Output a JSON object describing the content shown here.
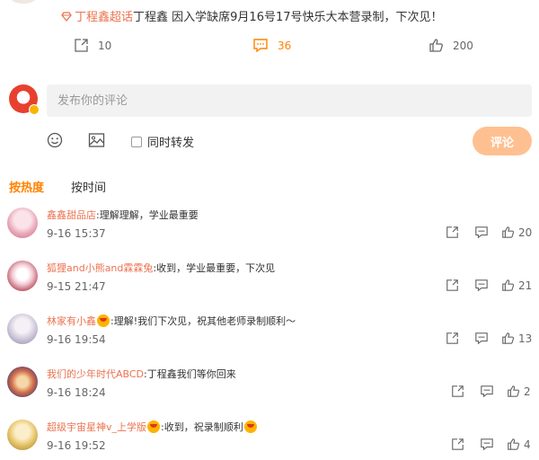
{
  "post": {
    "super_topic_link": "丁程鑫超话",
    "text": "丁程鑫 因入学缺席9月16号17号快乐大本营录制，下次见！",
    "repost_count": "10",
    "comment_count": "36",
    "like_count": "200"
  },
  "composer": {
    "placeholder": "发布你的评论",
    "repost_option": "同时转发",
    "submit_label": "评论",
    "icons": [
      "emoji-icon",
      "image-icon"
    ]
  },
  "sort_tabs": [
    {
      "label": "按热度",
      "active": true
    },
    {
      "label": "按时间",
      "active": false
    }
  ],
  "comments": [
    {
      "user": "鑫鑫甜品店",
      "text": ":理解理解，学业最重要",
      "emoji_after_user": false,
      "emoji_after_text": false,
      "time": "9-16 15:37",
      "likes": "20"
    },
    {
      "user": "狐狸and小熊and霖霖兔",
      "text": ":收到，学业最重要，下次见",
      "emoji_after_user": false,
      "emoji_after_text": false,
      "time": "9-15 21:47",
      "likes": "21"
    },
    {
      "user": "林家有小鑫",
      "text": ":理解!我们下次见，祝其他老师录制顺利～",
      "emoji_after_user": true,
      "emoji_after_text": false,
      "time": "9-16 19:54",
      "likes": "13"
    },
    {
      "user": "我们的少年时代ABCD",
      "text": ":丁程鑫我们等你回来",
      "emoji_after_user": false,
      "emoji_after_text": false,
      "time": "9-16 18:24",
      "likes": "2"
    },
    {
      "user": "超级宇宙星神v_上学版",
      "text": ":收到，祝录制顺利",
      "emoji_after_user": true,
      "emoji_after_text": true,
      "time": "9-16 19:52",
      "likes": "4"
    }
  ],
  "colors": {
    "accent": "#ff8200",
    "username": "#eb7350",
    "submit_disabled": "#ffc091",
    "input_bg": "#f2f2f2"
  }
}
